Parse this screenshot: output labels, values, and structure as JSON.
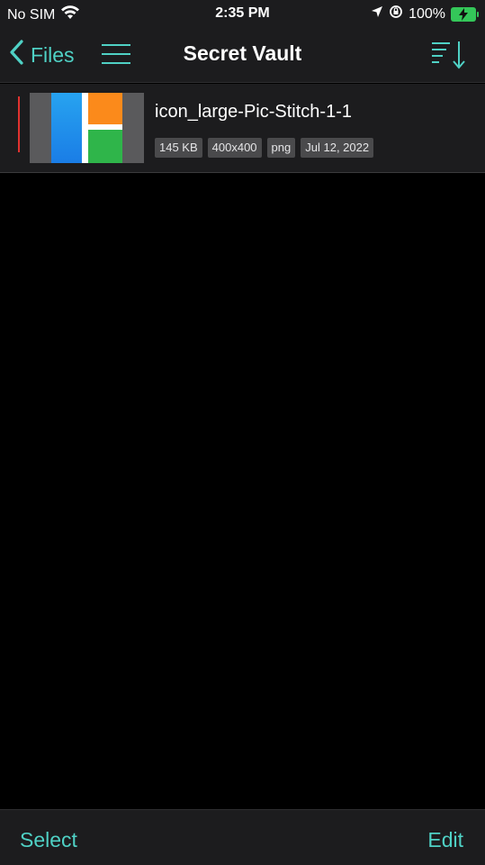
{
  "status_bar": {
    "carrier": "No SIM",
    "time": "2:35 PM",
    "battery_pct": "100%"
  },
  "nav": {
    "back_label": "Files",
    "title": "Secret Vault"
  },
  "files": [
    {
      "name": "icon_large-Pic-Stitch-1-1",
      "size": "145 KB",
      "dimensions": "400x400",
      "type": "png",
      "date": "Jul 12, 2022"
    }
  ],
  "toolbar": {
    "select_label": "Select",
    "edit_label": "Edit"
  },
  "colors": {
    "accent": "#4fd1c5",
    "bar_background": "#1c1c1e",
    "badge_background": "#4a4a4c",
    "marker": "#e0322f"
  },
  "icons": {
    "back": "chevron-left-icon",
    "menu": "hamburger-menu-icon",
    "sort": "sort-descending-icon",
    "wifi": "wifi-icon",
    "location": "location-arrow-icon",
    "orientation_lock": "orientation-lock-icon",
    "battery": "battery-charging-icon"
  }
}
